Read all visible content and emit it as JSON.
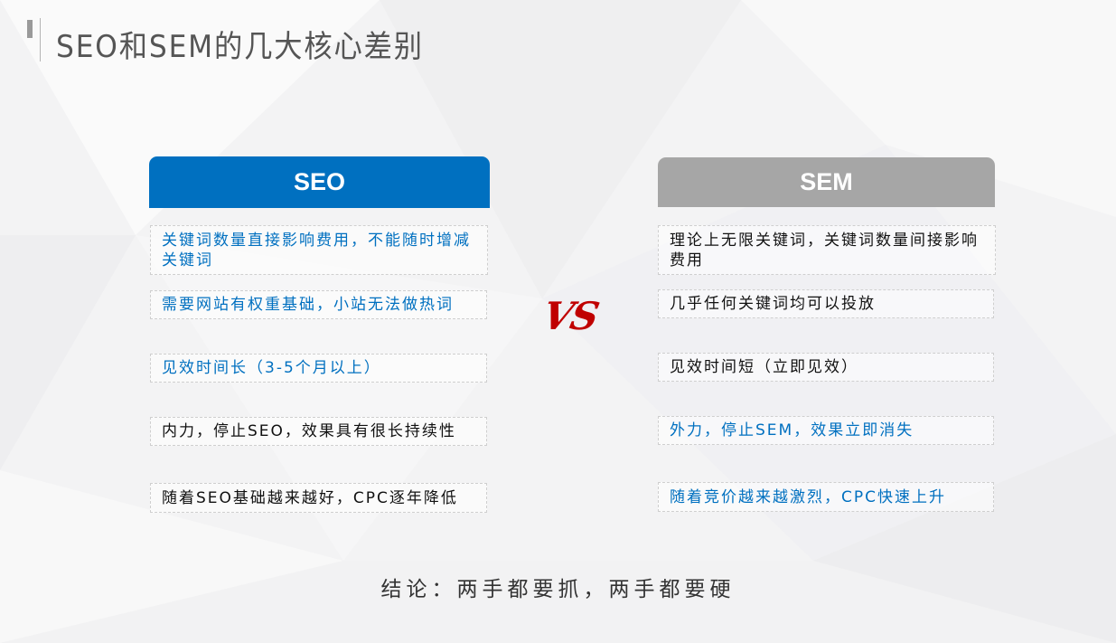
{
  "title": "SEO和SEM的几大核心差别",
  "seo": {
    "header": "SEO",
    "items": [
      "关键词数量直接影响费用，不能随时增减关键词",
      "需要网站有权重基础，小站无法做热词",
      "见效时间长（3-5个月以上）",
      "内力，停止SEO，效果具有很长持续性",
      "随着SEO基础越来越好，CPC逐年降低"
    ]
  },
  "sem": {
    "header": "SEM",
    "items": [
      "理论上无限关键词，关键词数量间接影响费用",
      "几乎任何关键词均可以投放",
      "见效时间短（立即见效）",
      "外力，停止SEM，效果立即消失",
      "随着竞价越来越激烈，CPC快速上升"
    ]
  },
  "vs_label": "VS",
  "conclusion": "结论：两手都要抓，两手都要硬",
  "colors": {
    "seo_blue": "#0070c0",
    "sem_gray": "#a6a6a6",
    "vs_red": "#c00000"
  }
}
